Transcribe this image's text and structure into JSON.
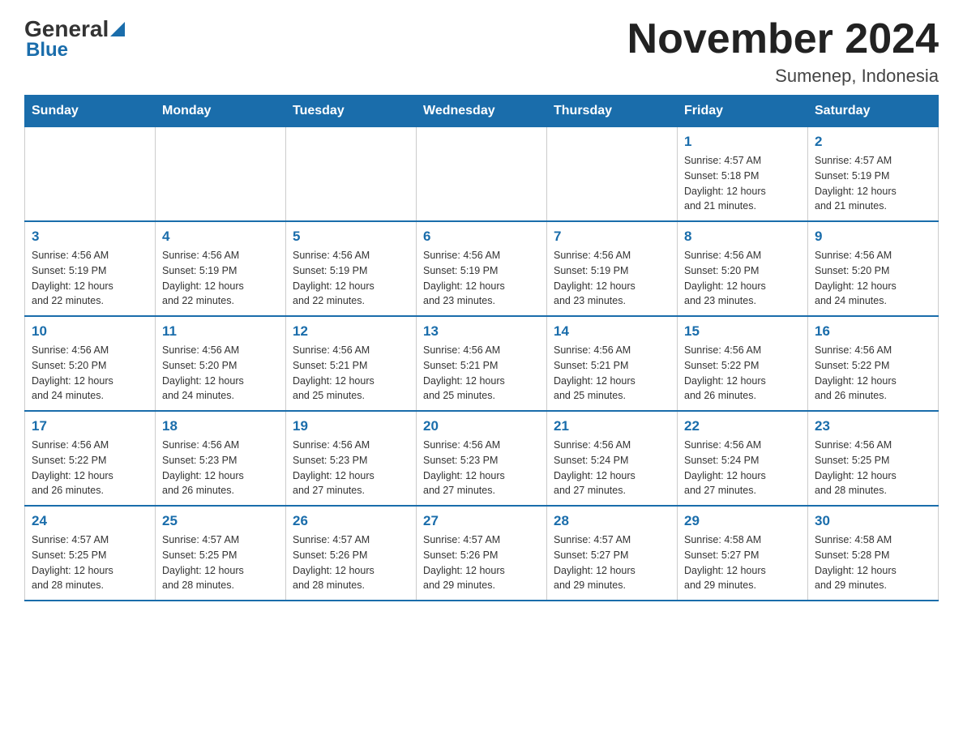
{
  "header": {
    "logo_text_general": "General",
    "logo_text_blue": "Blue",
    "main_title": "November 2024",
    "subtitle": "Sumenep, Indonesia"
  },
  "days_of_week": [
    "Sunday",
    "Monday",
    "Tuesday",
    "Wednesday",
    "Thursday",
    "Friday",
    "Saturday"
  ],
  "weeks": [
    [
      {
        "day": "",
        "info": ""
      },
      {
        "day": "",
        "info": ""
      },
      {
        "day": "",
        "info": ""
      },
      {
        "day": "",
        "info": ""
      },
      {
        "day": "",
        "info": ""
      },
      {
        "day": "1",
        "info": "Sunrise: 4:57 AM\nSunset: 5:18 PM\nDaylight: 12 hours\nand 21 minutes."
      },
      {
        "day": "2",
        "info": "Sunrise: 4:57 AM\nSunset: 5:19 PM\nDaylight: 12 hours\nand 21 minutes."
      }
    ],
    [
      {
        "day": "3",
        "info": "Sunrise: 4:56 AM\nSunset: 5:19 PM\nDaylight: 12 hours\nand 22 minutes."
      },
      {
        "day": "4",
        "info": "Sunrise: 4:56 AM\nSunset: 5:19 PM\nDaylight: 12 hours\nand 22 minutes."
      },
      {
        "day": "5",
        "info": "Sunrise: 4:56 AM\nSunset: 5:19 PM\nDaylight: 12 hours\nand 22 minutes."
      },
      {
        "day": "6",
        "info": "Sunrise: 4:56 AM\nSunset: 5:19 PM\nDaylight: 12 hours\nand 23 minutes."
      },
      {
        "day": "7",
        "info": "Sunrise: 4:56 AM\nSunset: 5:19 PM\nDaylight: 12 hours\nand 23 minutes."
      },
      {
        "day": "8",
        "info": "Sunrise: 4:56 AM\nSunset: 5:20 PM\nDaylight: 12 hours\nand 23 minutes."
      },
      {
        "day": "9",
        "info": "Sunrise: 4:56 AM\nSunset: 5:20 PM\nDaylight: 12 hours\nand 24 minutes."
      }
    ],
    [
      {
        "day": "10",
        "info": "Sunrise: 4:56 AM\nSunset: 5:20 PM\nDaylight: 12 hours\nand 24 minutes."
      },
      {
        "day": "11",
        "info": "Sunrise: 4:56 AM\nSunset: 5:20 PM\nDaylight: 12 hours\nand 24 minutes."
      },
      {
        "day": "12",
        "info": "Sunrise: 4:56 AM\nSunset: 5:21 PM\nDaylight: 12 hours\nand 25 minutes."
      },
      {
        "day": "13",
        "info": "Sunrise: 4:56 AM\nSunset: 5:21 PM\nDaylight: 12 hours\nand 25 minutes."
      },
      {
        "day": "14",
        "info": "Sunrise: 4:56 AM\nSunset: 5:21 PM\nDaylight: 12 hours\nand 25 minutes."
      },
      {
        "day": "15",
        "info": "Sunrise: 4:56 AM\nSunset: 5:22 PM\nDaylight: 12 hours\nand 26 minutes."
      },
      {
        "day": "16",
        "info": "Sunrise: 4:56 AM\nSunset: 5:22 PM\nDaylight: 12 hours\nand 26 minutes."
      }
    ],
    [
      {
        "day": "17",
        "info": "Sunrise: 4:56 AM\nSunset: 5:22 PM\nDaylight: 12 hours\nand 26 minutes."
      },
      {
        "day": "18",
        "info": "Sunrise: 4:56 AM\nSunset: 5:23 PM\nDaylight: 12 hours\nand 26 minutes."
      },
      {
        "day": "19",
        "info": "Sunrise: 4:56 AM\nSunset: 5:23 PM\nDaylight: 12 hours\nand 27 minutes."
      },
      {
        "day": "20",
        "info": "Sunrise: 4:56 AM\nSunset: 5:23 PM\nDaylight: 12 hours\nand 27 minutes."
      },
      {
        "day": "21",
        "info": "Sunrise: 4:56 AM\nSunset: 5:24 PM\nDaylight: 12 hours\nand 27 minutes."
      },
      {
        "day": "22",
        "info": "Sunrise: 4:56 AM\nSunset: 5:24 PM\nDaylight: 12 hours\nand 27 minutes."
      },
      {
        "day": "23",
        "info": "Sunrise: 4:56 AM\nSunset: 5:25 PM\nDaylight: 12 hours\nand 28 minutes."
      }
    ],
    [
      {
        "day": "24",
        "info": "Sunrise: 4:57 AM\nSunset: 5:25 PM\nDaylight: 12 hours\nand 28 minutes."
      },
      {
        "day": "25",
        "info": "Sunrise: 4:57 AM\nSunset: 5:25 PM\nDaylight: 12 hours\nand 28 minutes."
      },
      {
        "day": "26",
        "info": "Sunrise: 4:57 AM\nSunset: 5:26 PM\nDaylight: 12 hours\nand 28 minutes."
      },
      {
        "day": "27",
        "info": "Sunrise: 4:57 AM\nSunset: 5:26 PM\nDaylight: 12 hours\nand 29 minutes."
      },
      {
        "day": "28",
        "info": "Sunrise: 4:57 AM\nSunset: 5:27 PM\nDaylight: 12 hours\nand 29 minutes."
      },
      {
        "day": "29",
        "info": "Sunrise: 4:58 AM\nSunset: 5:27 PM\nDaylight: 12 hours\nand 29 minutes."
      },
      {
        "day": "30",
        "info": "Sunrise: 4:58 AM\nSunset: 5:28 PM\nDaylight: 12 hours\nand 29 minutes."
      }
    ]
  ]
}
